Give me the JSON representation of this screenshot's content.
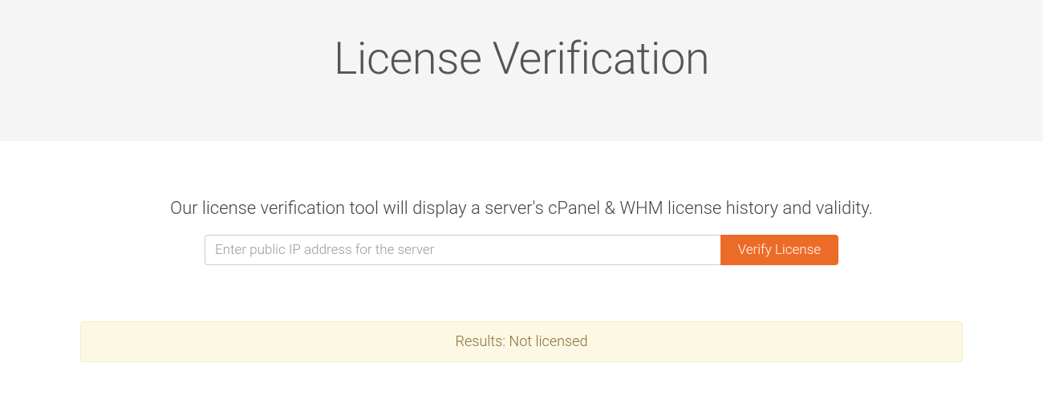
{
  "header": {
    "title": "License Verification"
  },
  "main": {
    "description": "Our license verification tool will display a server's cPanel & WHM license history and validity.",
    "ip_input_placeholder": "Enter public IP address for the server",
    "verify_button_label": "Verify License",
    "result_text": "Results: Not licensed"
  }
}
